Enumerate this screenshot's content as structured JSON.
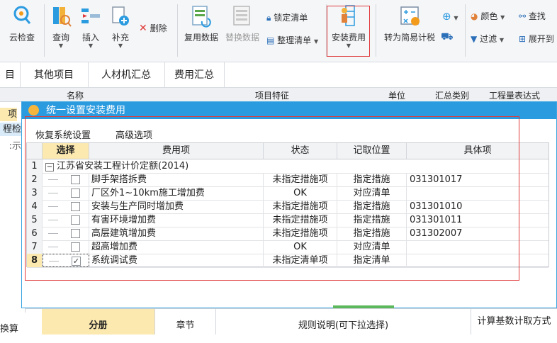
{
  "ribbon": {
    "cloud_check": "云检查",
    "query": "查询",
    "insert": "插入",
    "supplement": "补充",
    "delete": "删除",
    "reuse_data": "复用数据",
    "replace_data": "替换数据",
    "lock_list": "锁定清单",
    "organize_list": "整理清单",
    "install_fee": "安装费用",
    "to_simple": "转为简易计税",
    "color": "颜色",
    "find": "查找",
    "filter": "过滤",
    "expand_to": "展开到"
  },
  "tabs": [
    "目",
    "其他项目",
    "人材机汇总",
    "费用汇总"
  ],
  "background_header": {
    "name": "名称",
    "feature": "项目特征",
    "unit": "单位",
    "summary": "汇总类别",
    "formula": "工程量表达式"
  },
  "left_items": [
    "项目",
    "程检",
    "示:"
  ],
  "dialog": {
    "title": "统一设置安装费用",
    "menu": [
      "恢复系统设置",
      "高级选项"
    ],
    "columns": [
      "选择",
      "费用项",
      "状态",
      "记取位置",
      "具体项"
    ],
    "group_row": {
      "num": "1",
      "label": "江苏省安装工程计价定额(2014)"
    },
    "rows": [
      {
        "num": "2",
        "checked": false,
        "item": "脚手架搭拆费",
        "status": "未指定措施项",
        "position": "指定措施",
        "detail": "031301017"
      },
      {
        "num": "3",
        "checked": false,
        "item": "厂区外1~10km施工增加费",
        "status": "OK",
        "position": "对应清单",
        "detail": ""
      },
      {
        "num": "4",
        "checked": false,
        "item": "安装与生产同时增加费",
        "status": "未指定措施项",
        "position": "指定措施",
        "detail": "031301010"
      },
      {
        "num": "5",
        "checked": false,
        "item": "有害环境增加费",
        "status": "未指定措施项",
        "position": "指定措施",
        "detail": "031301011"
      },
      {
        "num": "6",
        "checked": false,
        "item": "高层建筑增加费",
        "status": "未指定措施项",
        "position": "指定措施",
        "detail": "031302007"
      },
      {
        "num": "7",
        "checked": false,
        "item": "超高增加费",
        "status": "OK",
        "position": "对应清单",
        "detail": ""
      },
      {
        "num": "8",
        "checked": true,
        "item": "系统调试费",
        "status": "未指定清单项",
        "position": "指定清单",
        "detail": ""
      }
    ]
  },
  "bottom": {
    "left": "换算",
    "fenche": "分册",
    "chapter": "章节",
    "rules": "规则说明(可下拉选择)",
    "calc_base": "计算基数计取方式"
  },
  "colors": {
    "accent": "#2b9be0",
    "highlight": "#e03a3a",
    "selected_header": "#fbe9b0"
  }
}
